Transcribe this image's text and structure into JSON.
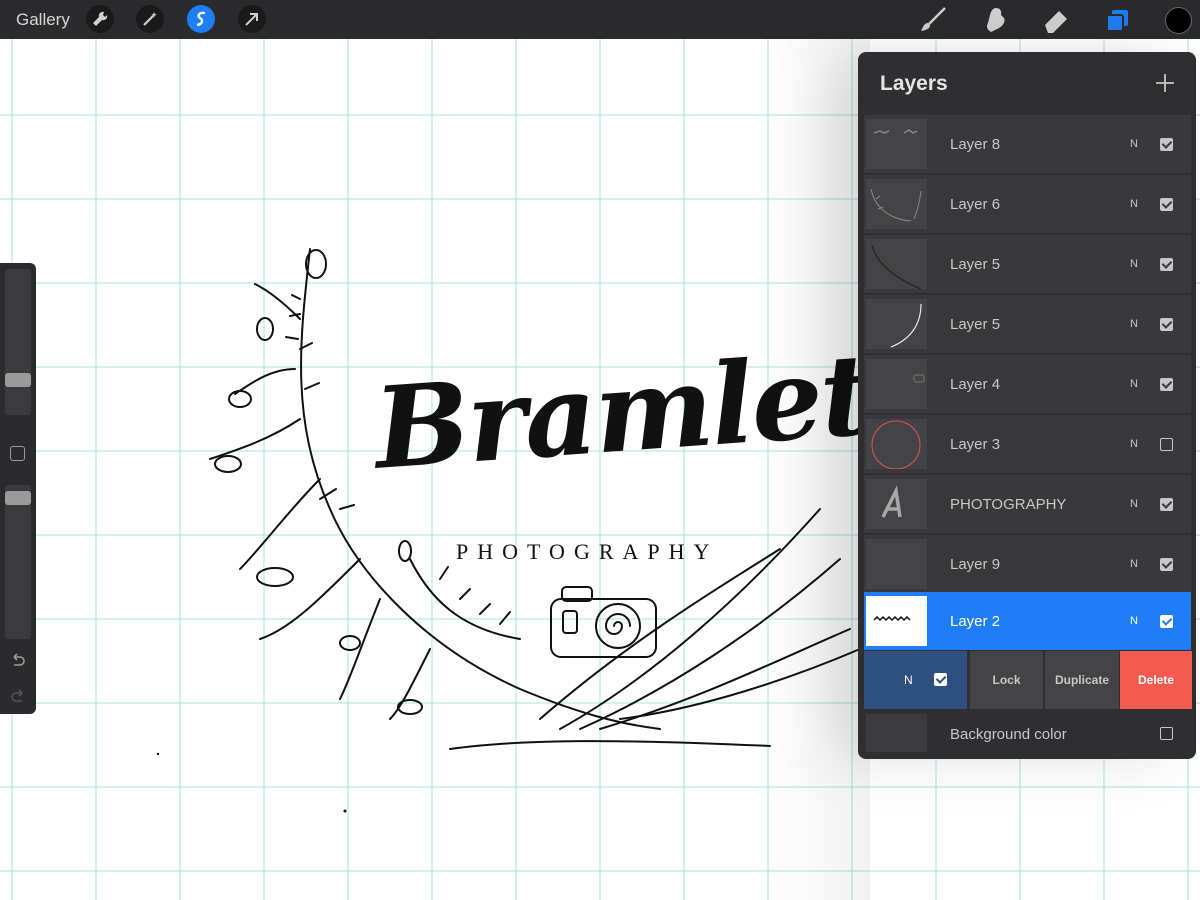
{
  "topbar": {
    "gallery_label": "Gallery",
    "left_tools": [
      {
        "icon": "wrench-icon"
      },
      {
        "icon": "magic-wand-icon"
      },
      {
        "icon": "selection-icon",
        "active": true
      },
      {
        "icon": "transform-arrow-icon"
      }
    ],
    "right_tools": [
      {
        "icon": "brush-icon"
      },
      {
        "icon": "smudge-icon"
      },
      {
        "icon": "eraser-icon"
      },
      {
        "icon": "layers-icon",
        "active": true
      }
    ],
    "current_color": "#000000"
  },
  "canvas": {
    "logo_title": "Bramlett",
    "logo_subtitle": "PHOTOGRAPHY",
    "grid_color": "#a8e3dc"
  },
  "layers_panel": {
    "title": "Layers",
    "layers": [
      {
        "name": "Layer 8",
        "blend": "N",
        "visible": true
      },
      {
        "name": "Layer 6",
        "blend": "N",
        "visible": true
      },
      {
        "name": "Layer 5",
        "blend": "N",
        "visible": true
      },
      {
        "name": "Layer 5",
        "blend": "N",
        "visible": true
      },
      {
        "name": "Layer 4",
        "blend": "N",
        "visible": true
      },
      {
        "name": "Layer 3",
        "blend": "N",
        "visible": false
      },
      {
        "name": "PHOTOGRAPHY",
        "blend": "N",
        "visible": true
      },
      {
        "name": "Layer 9",
        "blend": "N",
        "visible": true
      },
      {
        "name": "Layer 2",
        "blend": "N",
        "visible": true,
        "selected": true
      }
    ],
    "actions": {
      "blend": "N",
      "lock": "Lock",
      "duplicate": "Duplicate",
      "delete": "Delete"
    },
    "background": {
      "name": "Background color",
      "visible": false
    }
  },
  "colors": {
    "accent": "#1f7ef5",
    "delete": "#f45b4f",
    "panel_bg": "#2f2f31"
  }
}
